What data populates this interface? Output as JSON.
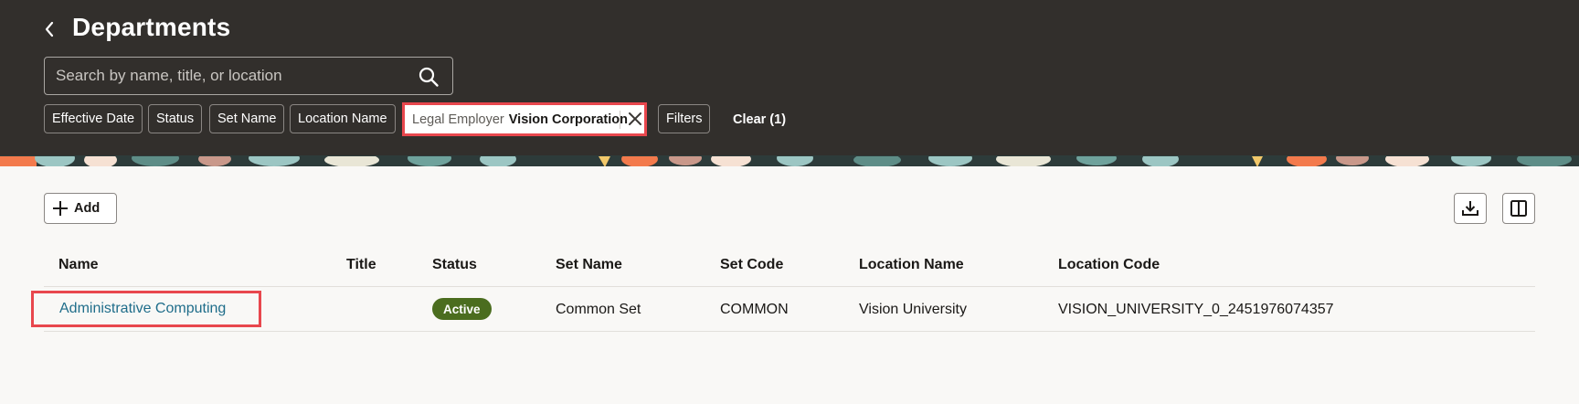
{
  "header": {
    "title": "Departments",
    "search": {
      "placeholder": "Search by name, title, or location",
      "value": ""
    },
    "filter_chips": [
      "Effective Date",
      "Status",
      "Set Name",
      "Location Name"
    ],
    "active_filter": {
      "label": "Legal Employer",
      "value": "Vision Corporation"
    },
    "filters_label": "Filters",
    "clear_label": "Clear (1)"
  },
  "toolbar": {
    "add_label": "Add"
  },
  "table": {
    "columns": [
      "Name",
      "Title",
      "Status",
      "Set Name",
      "Set Code",
      "Location Name",
      "Location Code"
    ],
    "rows": [
      {
        "name": "Administrative Computing",
        "title": "",
        "status": "Active",
        "set_name": "Common Set",
        "set_code": "COMMON",
        "location_name": "Vision University",
        "location_code": "VISION_UNIVERSITY_0_2451976074357"
      }
    ]
  },
  "colors": {
    "header_bg": "#322f2c",
    "highlight": "#e8474d",
    "link": "#1f6d8a",
    "badge_active": "#4b6d1f",
    "page_bg": "#f9f8f6"
  },
  "icons": [
    "chevron-left-icon",
    "search-icon",
    "close-icon",
    "plus-icon",
    "download-icon",
    "column-layout-icon"
  ]
}
